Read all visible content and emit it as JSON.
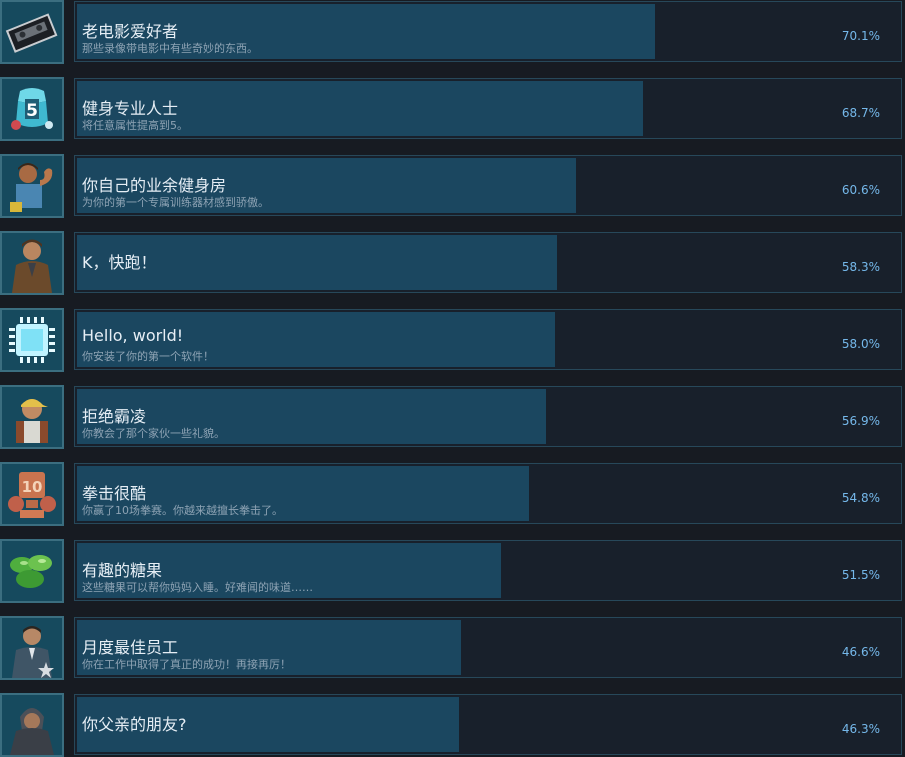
{
  "achievements": [
    {
      "id": "vhs",
      "title": "老电影爱好者",
      "desc": "那些录像带电影中有些奇妙的东西。",
      "percent_label": "70.1%",
      "percent": 70.1,
      "icon": "vhs-tape-icon"
    },
    {
      "id": "fit",
      "title": "健身专业人士",
      "desc": "将任意属性提高到5。",
      "percent_label": "68.7%",
      "percent": 68.7,
      "icon": "stat-five-icon"
    },
    {
      "id": "gym",
      "title": "你自己的业余健身房",
      "desc": "为你的第一个专属训练器材感到骄傲。",
      "percent_label": "60.6%",
      "percent": 60.6,
      "icon": "muscle-man-icon"
    },
    {
      "id": "run",
      "title": "K，快跑！",
      "desc": "",
      "percent_label": "58.3%",
      "percent": 58.3,
      "icon": "coat-man-icon"
    },
    {
      "id": "hello",
      "title": "Hello, world!",
      "desc": "你安装了你的第一个软件！",
      "percent_label": "58.0%",
      "percent": 58.0,
      "icon": "chip-icon"
    },
    {
      "id": "bully",
      "title": "拒绝霸凌",
      "desc": "你教会了那个家伙一些礼貌。",
      "percent_label": "56.9%",
      "percent": 56.9,
      "icon": "cap-man-icon"
    },
    {
      "id": "boxing",
      "title": "拳击很酷",
      "desc": "你赢了10场拳赛。你越来越擅长拳击了。",
      "percent_label": "54.8%",
      "percent": 54.8,
      "icon": "boxing-trophy-icon"
    },
    {
      "id": "candy",
      "title": "有趣的糖果",
      "desc": "这些糖果可以帮你妈妈入睡。好难闻的味道……",
      "percent_label": "51.5%",
      "percent": 51.5,
      "icon": "green-candy-icon"
    },
    {
      "id": "employee",
      "title": "月度最佳员工",
      "desc": "你在工作中取得了真正的成功！再接再厉！",
      "percent_label": "46.6%",
      "percent": 46.6,
      "icon": "suit-man-icon"
    },
    {
      "id": "friend",
      "title": "你父亲的朋友?",
      "desc": "",
      "percent_label": "46.3%",
      "percent": 46.3,
      "icon": "hooded-man-icon"
    }
  ]
}
